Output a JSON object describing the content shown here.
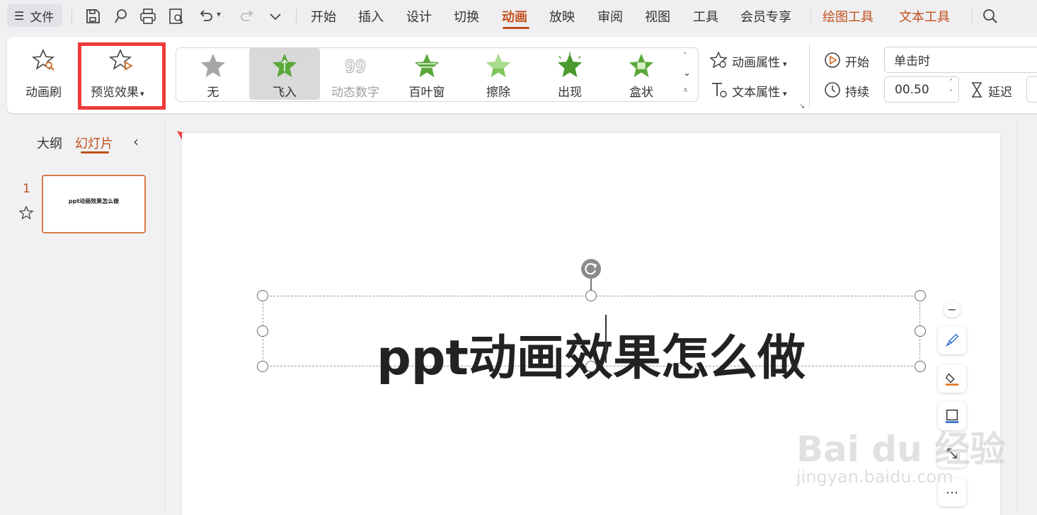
{
  "menubar": {
    "file_label": "文件",
    "tabs": [
      {
        "label": "开始"
      },
      {
        "label": "插入"
      },
      {
        "label": "设计"
      },
      {
        "label": "切换"
      },
      {
        "label": "动画"
      },
      {
        "label": "放映"
      },
      {
        "label": "审阅"
      },
      {
        "label": "视图"
      },
      {
        "label": "工具"
      },
      {
        "label": "会员专享"
      }
    ],
    "context_tabs": [
      {
        "label": "绘图工具"
      },
      {
        "label": "文本工具"
      }
    ],
    "active_tab": "动画",
    "accent_color": "#c1501c"
  },
  "ribbon": {
    "painter_label": "动画刷",
    "preview_label": "预览效果",
    "gallery": [
      {
        "label": "无",
        "state": "normal"
      },
      {
        "label": "飞入",
        "state": "selected"
      },
      {
        "label": "动态数字",
        "state": "disabled"
      },
      {
        "label": "百叶窗",
        "state": "normal"
      },
      {
        "label": "擦除",
        "state": "normal"
      },
      {
        "label": "出现",
        "state": "normal"
      },
      {
        "label": "盒状",
        "state": "normal"
      }
    ],
    "anim_props_label": "动画属性",
    "text_props_label": "文本属性",
    "start_label": "开始",
    "start_value": "单击时",
    "duration_label": "持续",
    "duration_value": "00.50",
    "delay_label": "延迟"
  },
  "left_panel": {
    "tab_outline": "大纲",
    "tab_slides": "幻灯片",
    "slide_number": "1",
    "thumb_title": "ppt动画效果怎么做"
  },
  "slide": {
    "title": "ppt动画效果怎么做"
  },
  "annotation_color": "#f03a3a"
}
